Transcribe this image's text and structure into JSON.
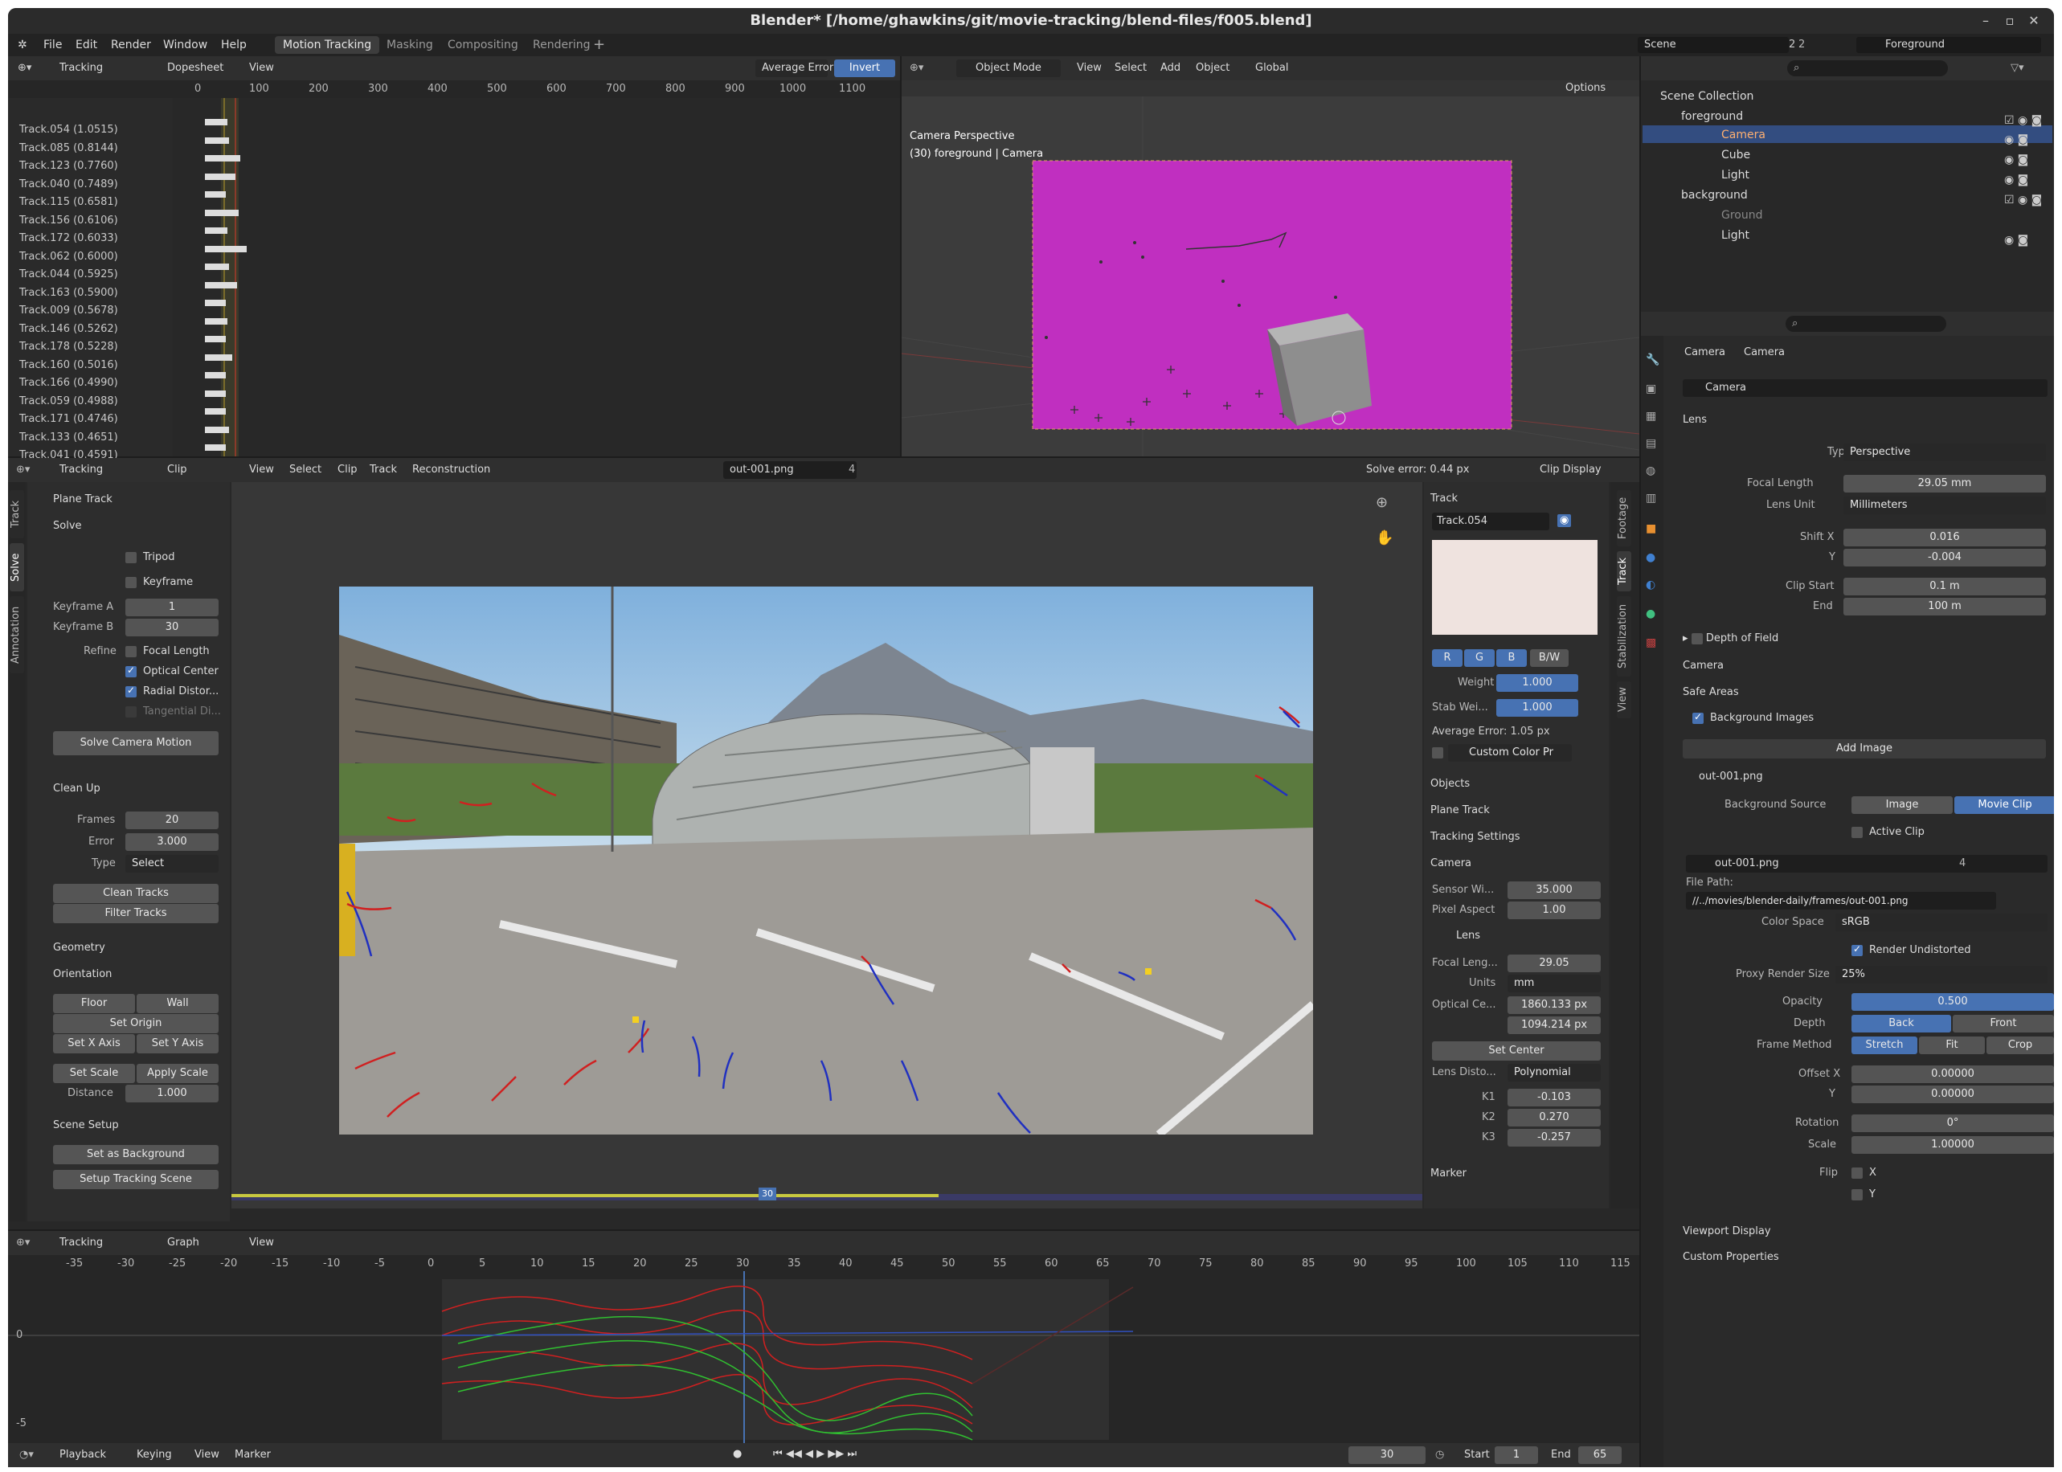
{
  "window": {
    "title": "Blender* [/home/ghawkins/git/movie-tracking/blend-files/f005.blend]"
  },
  "menu": [
    "File",
    "Edit",
    "Render",
    "Window",
    "Help"
  ],
  "workspaces": [
    "Motion Tracking",
    "Masking",
    "Compositing",
    "Rendering"
  ],
  "scene": {
    "name": "Scene",
    "users": "2",
    "view_layer": "Foreground"
  },
  "dopesheet": {
    "mode": "Tracking",
    "view": "Dopesheet",
    "menu_view": "View",
    "sort": "Average Error",
    "invert": "Invert",
    "ticks": [
      "0",
      "100",
      "200",
      "300",
      "400",
      "500",
      "600",
      "700",
      "800",
      "900",
      "1000",
      "1100"
    ],
    "tracks": [
      "Track.054 (1.0515)",
      "Track.085 (0.8144)",
      "Track.123 (0.7760)",
      "Track.040 (0.7489)",
      "Track.115 (0.6581)",
      "Track.156 (0.6106)",
      "Track.172 (0.6033)",
      "Track.062 (0.6000)",
      "Track.044 (0.5925)",
      "Track.163 (0.5900)",
      "Track.009 (0.5678)",
      "Track.146 (0.5262)",
      "Track.178 (0.5228)",
      "Track.160 (0.5016)",
      "Track.166 (0.4990)",
      "Track.059 (0.4988)",
      "Track.171 (0.4746)",
      "Track.133 (0.4651)",
      "Track.041 (0.4591)"
    ]
  },
  "viewport": {
    "mode": "Object Mode",
    "menus": [
      "View",
      "Select",
      "Add",
      "Object"
    ],
    "orientation": "Global",
    "options": "Options",
    "line1": "Camera Perspective",
    "line2": "(30) foreground | Camera"
  },
  "outliner": {
    "root": "Scene Collection",
    "items": [
      {
        "name": "foreground"
      },
      {
        "name": "Camera"
      },
      {
        "name": "Cube"
      },
      {
        "name": "Light"
      },
      {
        "name": "background"
      },
      {
        "name": "Ground"
      },
      {
        "name": "Light"
      }
    ]
  },
  "clip_editor": {
    "mode": "Tracking",
    "view": "Clip",
    "menus": [
      "View",
      "Select",
      "Clip",
      "Track",
      "Reconstruction"
    ],
    "clip_name": "out-001.png",
    "clip_users": "4",
    "solve_error": "Solve error: 0.44 px",
    "display": "Clip Display",
    "frame_marker": "30"
  },
  "left_panel": {
    "vtabs": [
      "Track",
      "Solve",
      "Annotation"
    ],
    "plane_track": "Plane Track",
    "solve": "Solve",
    "tripod": "Tripod",
    "keyframe": "Keyframe",
    "keyframe_a_label": "Keyframe A",
    "keyframe_a": "1",
    "keyframe_b_label": "Keyframe B",
    "keyframe_b": "30",
    "refine": "Refine",
    "focal_length": "Focal Length",
    "optical_center": "Optical Center",
    "radial": "Radial Distor...",
    "tangential": "Tangential Di...",
    "solve_btn": "Solve Camera Motion",
    "cleanup": "Clean Up",
    "frames_label": "Frames",
    "frames": "20",
    "error_label": "Error",
    "error": "3.000",
    "type_label": "Type",
    "type": "Select",
    "clean_tracks": "Clean Tracks",
    "filter_tracks": "Filter Tracks",
    "geometry": "Geometry",
    "orientation": "Orientation",
    "floor": "Floor",
    "wall": "Wall",
    "set_origin": "Set Origin",
    "set_x": "Set X Axis",
    "set_y": "Set Y Axis",
    "set_scale": "Set Scale",
    "apply_scale": "Apply Scale",
    "distance_label": "Distance",
    "distance": "1.000",
    "scene_setup": "Scene Setup",
    "set_bg": "Set as Background",
    "setup_scene": "Setup Tracking Scene"
  },
  "track_panel": {
    "header": "Track",
    "name": "Track.054",
    "r": "R",
    "g": "G",
    "b": "B",
    "bw": "B/W",
    "weight_label": "Weight",
    "weight": "1.000",
    "stab_label": "Stab Wei...",
    "stab": "1.000",
    "avg_error": "Average Error: 1.05 px",
    "custom_color": "Custom Color Pr",
    "objects": "Objects",
    "plane_track": "Plane Track",
    "tracking_settings": "Tracking Settings",
    "camera": "Camera",
    "sensor_label": "Sensor Wi...",
    "sensor": "35.000",
    "pixel_label": "Pixel Aspect",
    "pixel": "1.00",
    "lens": "Lens",
    "focal_label": "Focal Leng...",
    "focal": "29.05",
    "units_label": "Units",
    "units": "mm",
    "optical_label": "Optical Ce...",
    "optical_x": "1860.133 px",
    "optical_y": "1094.214 px",
    "set_center": "Set Center",
    "distort_label": "Lens Disto...",
    "distort": "Polynomial",
    "k1_label": "K1",
    "k1": "-0.103",
    "k2_label": "K2",
    "k2": "0.270",
    "k3_label": "K3",
    "k3": "-0.257",
    "marker": "Marker",
    "right_vtabs": [
      "Footage",
      "Track",
      "Stabilization",
      "View"
    ]
  },
  "graph": {
    "mode": "Tracking",
    "view": "Graph",
    "menu_view": "View",
    "ticks": [
      "-35",
      "-30",
      "-25",
      "-20",
      "-15",
      "-10",
      "-5",
      "0",
      "5",
      "10",
      "15",
      "20",
      "25",
      "30",
      "35",
      "40",
      "45",
      "50",
      "55",
      "60",
      "65",
      "70",
      "75",
      "80",
      "85",
      "90",
      "95",
      "100",
      "105",
      "110",
      "115"
    ],
    "y0": "0",
    "y_neg5": "-5"
  },
  "timeline": {
    "playback": "Playback",
    "keying": "Keying",
    "view": "View",
    "marker": "Marker",
    "current": "30",
    "start_label": "Start",
    "start": "1",
    "end_label": "End",
    "end": "65"
  },
  "properties": {
    "crumb1": "Camera",
    "crumb2": "Camera",
    "data_name": "Camera",
    "lens": "Lens",
    "type_label": "Type",
    "type": "Perspective",
    "focal_label": "Focal Length",
    "focal": "29.05 mm",
    "lens_unit_label": "Lens Unit",
    "lens_unit": "Millimeters",
    "shift_x_label": "Shift X",
    "shift_x": "0.016",
    "y_label": "Y",
    "shift_y": "-0.004",
    "clip_start_label": "Clip Start",
    "clip_start": "0.1 m",
    "end_label": "End",
    "clip_end": "100 m",
    "dof": "Depth of Field",
    "camera": "Camera",
    "safe_areas": "Safe Areas",
    "bg_images": "Background Images",
    "add_image": "Add Image",
    "img_name": "out-001.png",
    "bg_source_label": "Background Source",
    "image": "Image",
    "movie_clip": "Movie Clip",
    "active_clip": "Active Clip",
    "clip_name": "out-001.png",
    "clip_users": "4",
    "file_path_label": "File Path:",
    "file_path": "//../movies/blender-daily/frames/out-001.png",
    "color_space_label": "Color Space",
    "color_space": "sRGB",
    "render_undistorted": "Render Undistorted",
    "proxy_label": "Proxy Render Size",
    "proxy": "25%",
    "opacity_label": "Opacity",
    "opacity": "0.500",
    "depth_label": "Depth",
    "back": "Back",
    "front": "Front",
    "frame_method_label": "Frame Method",
    "stretch": "Stretch",
    "fit": "Fit",
    "crop": "Crop",
    "offset_x_label": "Offset X",
    "offset_x": "0.00000",
    "offset_y_label": "Y",
    "offset_y": "0.00000",
    "rotation_label": "Rotation",
    "rotation": "0°",
    "scale_label": "Scale",
    "scale": "1.00000",
    "flip_label": "Flip",
    "flip_x": "X",
    "flip_y": "Y",
    "viewport_display": "Viewport Display",
    "custom_props": "Custom Properties"
  },
  "colors": {
    "accent": "#4772b3",
    "magenta": "#c02fc0",
    "bg": "#1d1d1d",
    "panel": "#303030"
  }
}
